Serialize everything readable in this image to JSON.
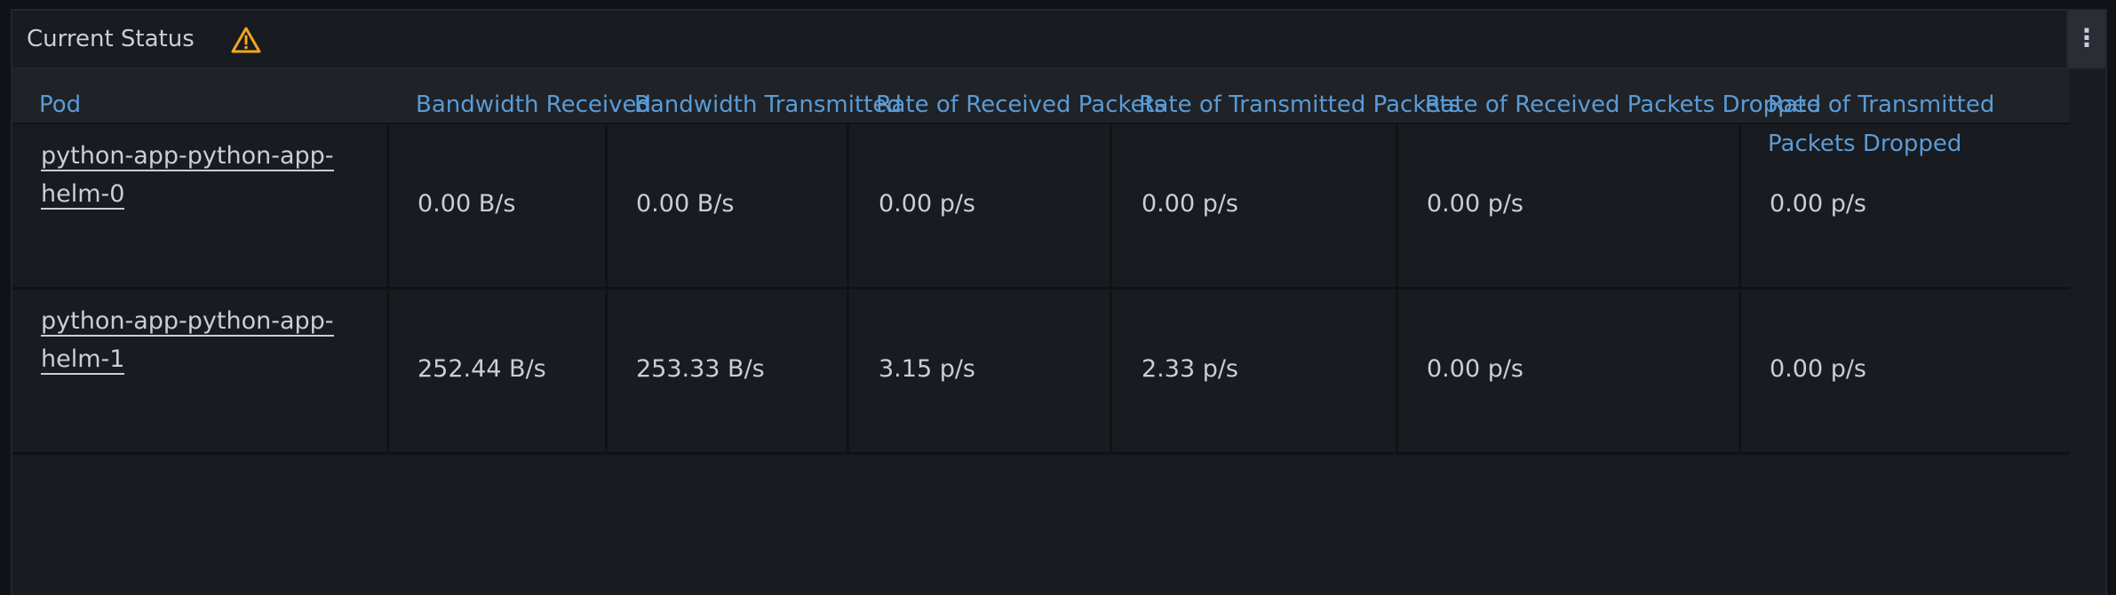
{
  "panel": {
    "title": "Current Status",
    "warning_icon": "warning-triangle-icon",
    "menu_icon": "vertical-ellipsis-icon"
  },
  "table": {
    "columns": [
      "Pod",
      "Bandwidth Received",
      "Bandwidth Transmitted",
      "Rate of Received Packets",
      "Rate of Transmitted Packets",
      "Rate of Received Packets Dropped",
      "Rate of Transmitted Packets Dropped"
    ],
    "rows": [
      {
        "pod": "python-app-python-app-helm-0",
        "bandwidth_received": "0.00 B/s",
        "bandwidth_transmitted": "0.00 B/s",
        "rx_packets": "0.00 p/s",
        "tx_packets": "0.00 p/s",
        "rx_dropped": "0.00 p/s",
        "tx_dropped": "0.00 p/s"
      },
      {
        "pod": "python-app-python-app-helm-1",
        "bandwidth_received": "252.44 B/s",
        "bandwidth_transmitted": "253.33 B/s",
        "rx_packets": "3.15 p/s",
        "tx_packets": "2.33 p/s",
        "rx_dropped": "0.00 p/s",
        "tx_dropped": "0.00 p/s"
      }
    ]
  },
  "colors": {
    "header_text": "#5b9bd5",
    "warning": "#f5a524",
    "cell_text": "#ccccdc"
  }
}
